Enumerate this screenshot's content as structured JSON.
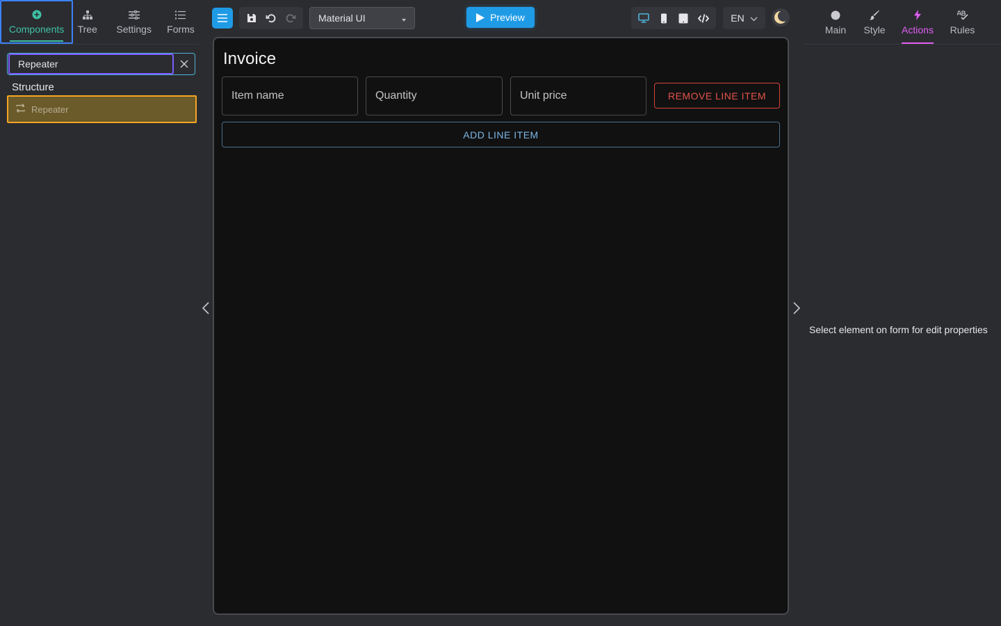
{
  "left_panel": {
    "tabs": [
      {
        "label": "Components",
        "icon": "plus-circle-icon"
      },
      {
        "label": "Tree",
        "icon": "tree-icon"
      },
      {
        "label": "Settings",
        "icon": "sliders-icon"
      },
      {
        "label": "Forms",
        "icon": "list-icon"
      }
    ],
    "search_value": "Repeater",
    "section_title": "Structure",
    "component_item": "Repeater"
  },
  "toolbar": {
    "library_select": "Material UI",
    "preview_label": "Preview",
    "language": "EN"
  },
  "canvas": {
    "form_title": "Invoice",
    "fields": [
      "Item name",
      "Quantity",
      "Unit price"
    ],
    "remove_label": "REMOVE LINE ITEM",
    "add_label": "ADD LINE ITEM"
  },
  "right_panel": {
    "tabs": [
      {
        "label": "Main",
        "icon": "circle-icon"
      },
      {
        "label": "Style",
        "icon": "brush-icon"
      },
      {
        "label": "Actions",
        "icon": "lightning-icon"
      },
      {
        "label": "Rules",
        "icon": "rules-icon"
      }
    ],
    "empty_message": "Select element on form for edit properties"
  },
  "colors": {
    "accent_blue": "#1f9be6",
    "components_active": "#3ec2a6",
    "actions_active": "#e05ef2",
    "danger": "#e5534b",
    "highlight_orange": "#f5a623"
  }
}
